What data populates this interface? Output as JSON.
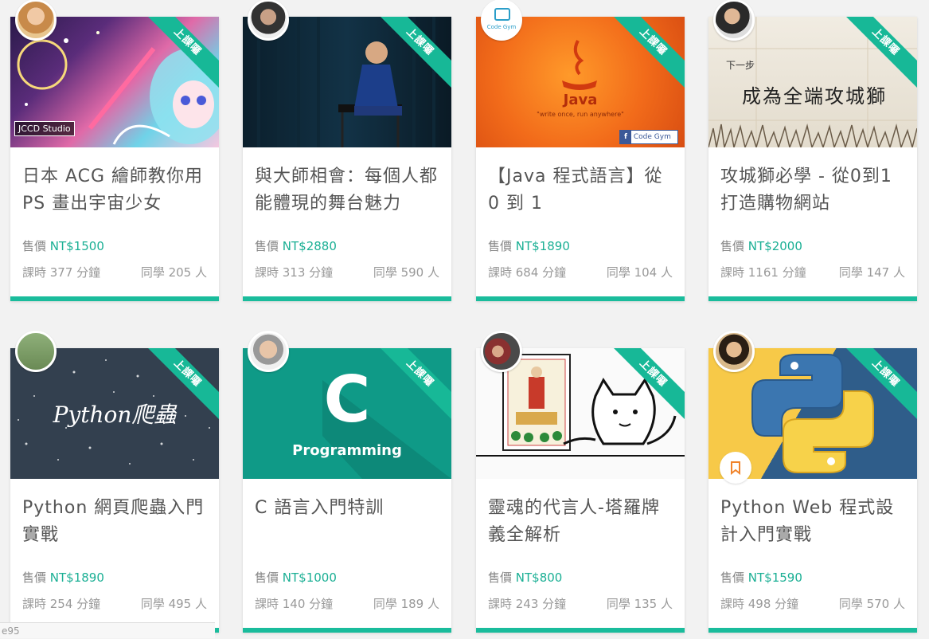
{
  "ribbon_label": "上課囉",
  "price_prefix": "售價",
  "colors": {
    "accent": "#1abc9c",
    "price": "#1aaf94",
    "text": "#555555"
  },
  "courses": [
    {
      "title": "日本 ACG 繪師教你用 PS 畫出宇宙少女",
      "price": "NT$1500",
      "duration": "課時 377 分鐘",
      "students": "同學 205 人",
      "cover_text": "JCCD Studio"
    },
    {
      "title": "與大師相會：每個人都能體現的舞台魅力",
      "price": "NT$2880",
      "duration": "課時 313 分鐘",
      "students": "同學 590 人"
    },
    {
      "title": "【Java 程式語言】從 0 到 1",
      "price": "NT$1890",
      "duration": "課時 684 分鐘",
      "students": "同學 104 人",
      "cover_text": "Java",
      "cover_subtext": "\"write once, run anywhere\"",
      "cover_badge": "Code Gym",
      "avatar_text": "Code Gym"
    },
    {
      "title": "攻城獅必學 - 從0到1打造購物網站",
      "price": "NT$2000",
      "duration": "課時 1161 分鐘",
      "students": "同學 147 人",
      "cover_small": "下一步",
      "cover_text": "成為全端攻城獅"
    },
    {
      "title": "Python 網頁爬蟲入門實戰",
      "price": "NT$1890",
      "duration": "課時 254 分鐘",
      "students": "同學 495 人",
      "cover_text": "Python爬蟲"
    },
    {
      "title": "C 語言入門特訓",
      "price": "NT$1000",
      "duration": "課時 140 分鐘",
      "students": "同學 189 人",
      "cover_letter": "C",
      "cover_text": "Programming"
    },
    {
      "title": "靈魂的代言人-塔羅牌義全解析",
      "price": "NT$800",
      "duration": "課時 243 分鐘",
      "students": "同學 135 人"
    },
    {
      "title": "Python Web 程式設計入門實戰",
      "price": "NT$1590",
      "duration": "課時 498 分鐘",
      "students": "同學 570 人"
    }
  ],
  "status_bar": "e95"
}
